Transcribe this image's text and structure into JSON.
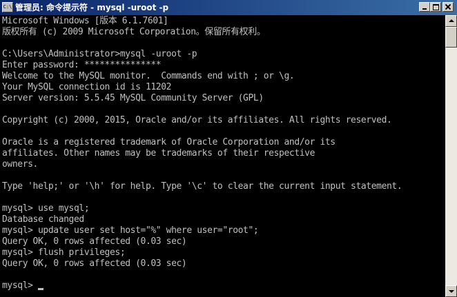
{
  "window": {
    "icon_label": "C:\\",
    "title": "管理员: 命令提示符 - mysql  -uroot -p",
    "colors": {
      "titlebar_start": "#0a246a",
      "titlebar_end": "#3a6ea5",
      "console_bg": "#000000",
      "console_text": "#c0c0c0"
    }
  },
  "console": {
    "lines": [
      "Microsoft Windows [版本 6.1.7601]",
      "版权所有 (c) 2009 Microsoft Corporation。保留所有权利。",
      "",
      "C:\\Users\\Administrator>mysql -uroot -p",
      "Enter password: ***************",
      "Welcome to the MySQL monitor.  Commands end with ; or \\g.",
      "Your MySQL connection id is 11202",
      "Server version: 5.5.45 MySQL Community Server (GPL)",
      "",
      "Copyright (c) 2000, 2015, Oracle and/or its affiliates. All rights reserved.",
      "",
      "Oracle is a registered trademark of Oracle Corporation and/or its",
      "affiliates. Other names may be trademarks of their respective",
      "owners.",
      "",
      "Type 'help;' or '\\h' for help. Type '\\c' to clear the current input statement.",
      "",
      "mysql> use mysql;",
      "Database changed",
      "mysql> update user set host=\"%\" where user=\"root\";",
      "Query OK, 0 rows affected (0.03 sec)",
      "mysql> flush privileges;",
      "Query OK, 0 rows affected (0.03 sec)",
      "",
      "mysql> "
    ]
  }
}
